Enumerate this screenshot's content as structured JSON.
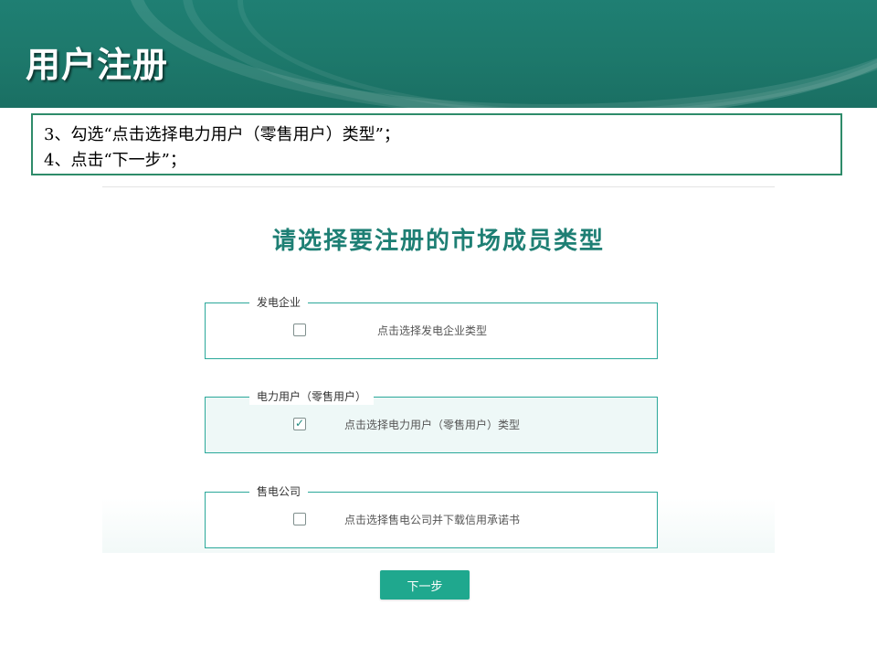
{
  "slide": {
    "title": "用户注册",
    "instructions": [
      "3、勾选“点击选择电力用户（零售用户）类型”；",
      "4、点击“下一步”；"
    ]
  },
  "form": {
    "title": "请选择要注册的市场成员类型",
    "options": [
      {
        "legend": "发电企业",
        "label": "点击选择发电企业类型",
        "checked": false,
        "check_mark": ""
      },
      {
        "legend": "电力用户（零售用户）",
        "label": "点击选择电力用户（零售用户）类型",
        "checked": true,
        "check_mark": "✓"
      },
      {
        "legend": "售电公司",
        "label": "点击选择售电公司并下载信用承诺书",
        "checked": false,
        "check_mark": ""
      }
    ],
    "next_label": "下一步"
  },
  "colors": {
    "header_bg": "#1d786b",
    "accent": "#1e7f74",
    "border": "#2aa89a",
    "button": "#1fa88e"
  }
}
